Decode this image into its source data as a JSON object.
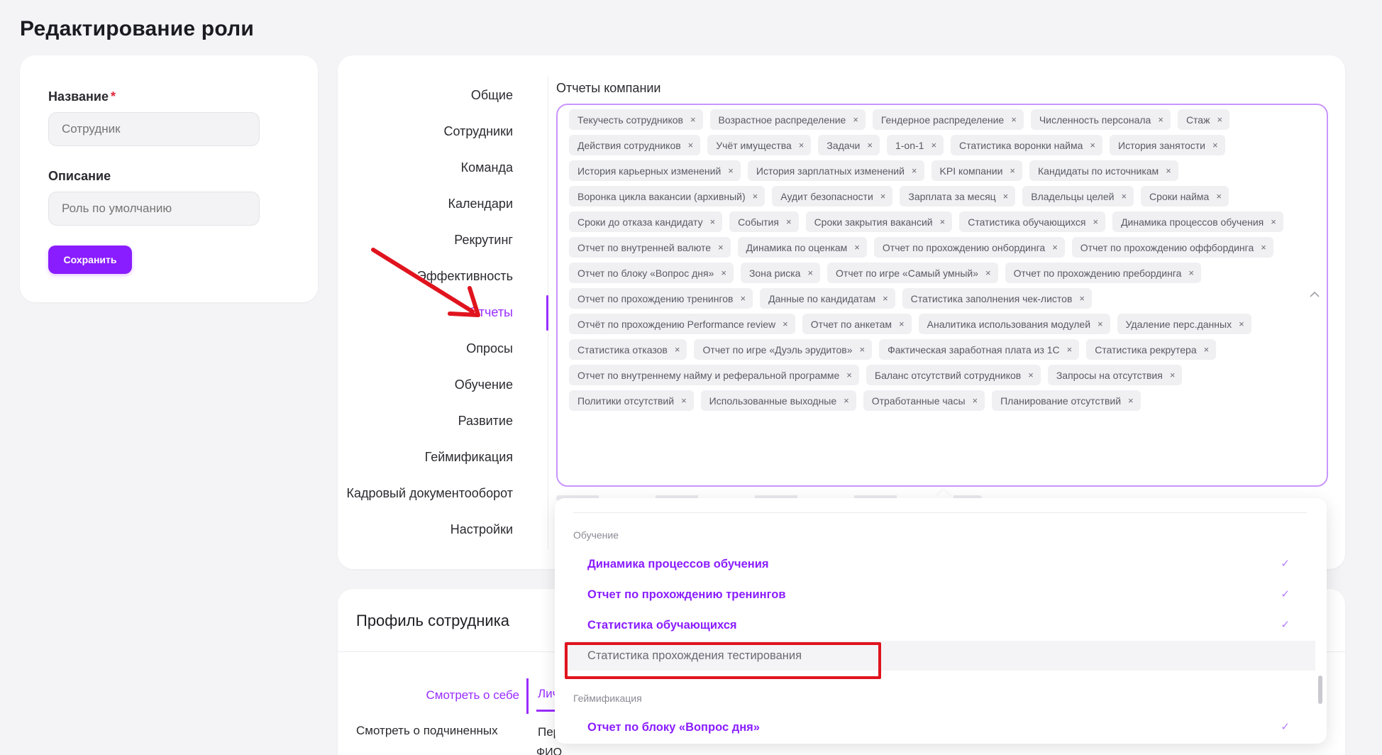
{
  "page_title": "Редактирование роли",
  "form": {
    "name_label": "Название",
    "required_mark": "*",
    "name_placeholder": "Сотрудник",
    "description_label": "Описание",
    "description_placeholder": "Роль по умолчанию",
    "save_label": "Сохранить"
  },
  "nav": {
    "items": [
      "Общие",
      "Сотрудники",
      "Команда",
      "Календари",
      "Рекрутинг",
      "Эффективность",
      "Отчеты",
      "Опросы",
      "Обучение",
      "Развитие",
      "Геймификация",
      "Кадровый документооборот",
      "Настройки"
    ],
    "active": "Отчеты"
  },
  "reports": {
    "label": "Отчеты компании",
    "tags": [
      "Текучесть сотрудников",
      "Возрастное распределение",
      "Гендерное распределение",
      "Численность персонала",
      "Стаж",
      "Действия сотрудников",
      "Учёт имущества",
      "Задачи",
      "1-on-1",
      "Статистика воронки найма",
      "История занятости",
      "История карьерных изменений",
      "История зарплатных изменений",
      "KPI компании",
      "Кандидаты по источникам",
      "Воронка цикла вакансии (архивный)",
      "Аудит безопасности",
      "Зарплата за месяц",
      "Владельцы целей",
      "Сроки найма",
      "Сроки до отказа кандидату",
      "События",
      "Сроки закрытия вакансий",
      "Статистика обучающихся",
      "Динамика процессов обучения",
      "Отчет по внутренней валюте",
      "Динамика по оценкам",
      "Отчет по прохождению онбординга",
      "Отчет по прохождению оффбординга",
      "Отчет по блоку «Вопрос дня»",
      "Зона риска",
      "Отчет по игре «Самый умный»",
      "Отчет по прохождению пребординга",
      "Отчет по прохождению тренингов",
      "Данные по кандидатам",
      "Статистика заполнения чек-листов",
      "Отчёт по прохождению Performance review",
      "Отчет по анкетам",
      "Аналитика использования модулей",
      "Удаление перс.данных",
      "Статистика отказов",
      "Отчет по игре «Дуэль эрудитов»",
      "Фактическая заработная плата из 1С",
      "Статистика рекрутера",
      "Отчет по внутреннему найму и реферальной программе",
      "Баланс отсутствий сотрудников",
      "Запросы на отсутствия",
      "Политики отсутствий",
      "Использованные выходные",
      "Отработанные часы",
      "Планирование отсутствий"
    ],
    "remove_glyph": "×",
    "collapse_glyph": "^"
  },
  "dropdown": {
    "groups": [
      {
        "name": "Обучение",
        "options": [
          {
            "label": "Динамика процессов обучения",
            "selected": true
          },
          {
            "label": "Отчет по прохождению тренингов",
            "selected": true
          },
          {
            "label": "Статистика обучающихся",
            "selected": true
          },
          {
            "label": "Статистика прохождения тестирования",
            "selected": false
          }
        ]
      },
      {
        "name": "Геймификация",
        "options": [
          {
            "label": "Отчет по блоку «Вопрос дня»",
            "selected": true
          }
        ]
      }
    ],
    "check_glyph": "✓"
  },
  "profile": {
    "title": "Профиль сотрудника",
    "sub_items": [
      "Смотреть о себе",
      "Смотреть о подчиненных"
    ],
    "active_sub": "Смотреть о себе",
    "tab_peek": "Лич",
    "col_peek1": "Пер",
    "col_peek2": "ФИО"
  },
  "colors": {
    "accent": "#8a1dff",
    "annotation": "#e0141e"
  }
}
